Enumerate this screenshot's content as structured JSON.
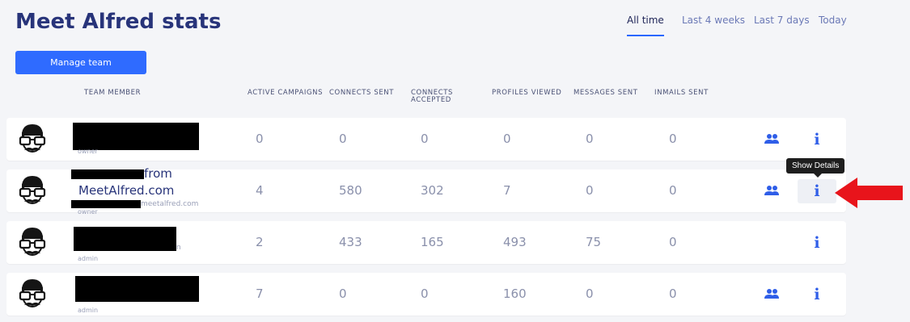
{
  "title": "Meet Alfred stats",
  "filters": [
    {
      "label": "All time",
      "active": true
    },
    {
      "label": "Last 4 weeks",
      "active": false
    },
    {
      "label": "Last 7 days",
      "active": false
    },
    {
      "label": "Today",
      "active": false
    }
  ],
  "manage_button": "Manage team",
  "columns": {
    "team_member": "TEAM MEMBER",
    "active_campaigns": "ACTIVE CAMPAIGNS",
    "connects_sent": "CONNECTS SENT",
    "connects_accepted_1": "CONNECTS",
    "connects_accepted_2": "ACCEPTED",
    "profiles_viewed": "PROFILES VIEWED",
    "messages_sent": "MESSAGES SENT",
    "inmails_sent": "INMAILS SENT"
  },
  "rows": [
    {
      "role": "owner",
      "name_visible": "",
      "email_fragment": "",
      "active_campaigns": "0",
      "connects_sent": "0",
      "connects_accepted": "0",
      "profiles_viewed": "0",
      "messages_sent": "0",
      "inmails_sent": "0",
      "has_team_icon": true
    },
    {
      "role": "owner",
      "name_visible": "from",
      "name_line2": "MeetAlfred.com",
      "email_fragment": "meetalfred.com",
      "active_campaigns": "4",
      "connects_sent": "580",
      "connects_accepted": "302",
      "profiles_viewed": "7",
      "messages_sent": "0",
      "inmails_sent": "0",
      "has_team_icon": true
    },
    {
      "role": "admin",
      "name_visible": "",
      "email_fragment": "n",
      "active_campaigns": "2",
      "connects_sent": "433",
      "connects_accepted": "165",
      "profiles_viewed": "493",
      "messages_sent": "75",
      "inmails_sent": "0",
      "has_team_icon": false
    },
    {
      "role": "admin",
      "name_visible": "",
      "email_fragment": "",
      "active_campaigns": "7",
      "connects_sent": "0",
      "connects_accepted": "0",
      "profiles_viewed": "160",
      "messages_sent": "0",
      "inmails_sent": "0",
      "has_team_icon": true
    }
  ],
  "tooltip": "Show Details",
  "icons": {
    "team": "team-icon",
    "info": "info-icon",
    "avatar": "avatar-glasses-mustache",
    "arrow": "red-arrow-pointer"
  },
  "colors": {
    "accent": "#2f6bff",
    "title": "#28347a",
    "annotation": "#e8141b"
  }
}
